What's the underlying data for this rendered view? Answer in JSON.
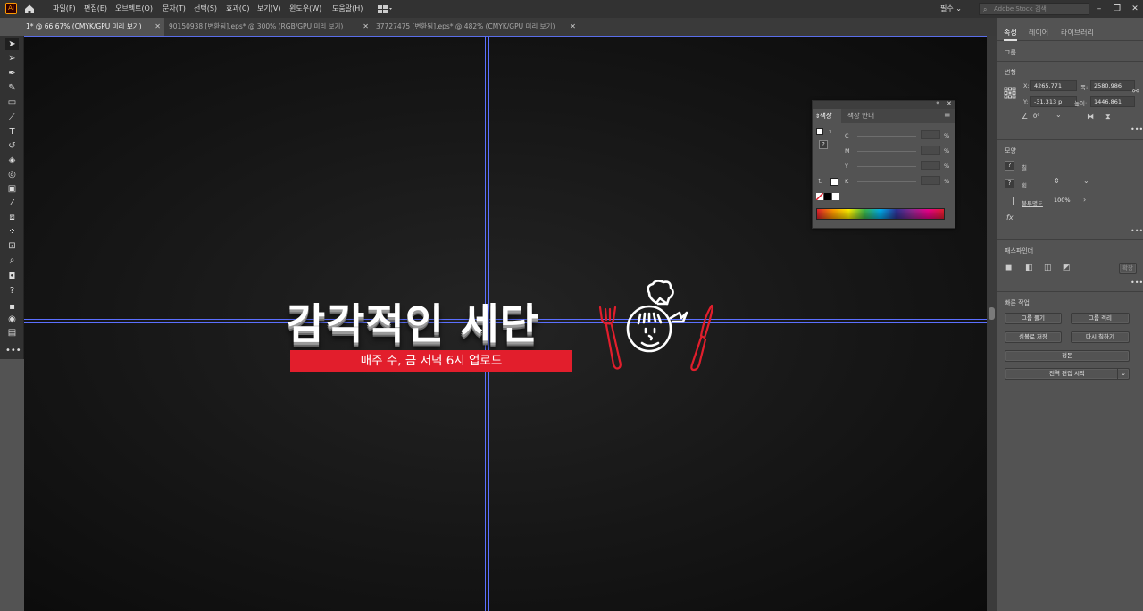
{
  "app": {
    "logo": "Ai"
  },
  "menu": [
    "파일(F)",
    "편집(E)",
    "오브젝트(O)",
    "문자(T)",
    "선택(S)",
    "효과(C)",
    "보기(V)",
    "윈도우(W)",
    "도움말(H)"
  ],
  "workspace": "필수",
  "search_placeholder": "Adobe Stock 검색",
  "tabs": [
    {
      "label": "1* @ 66.67% (CMYK/GPU 미리 보기)",
      "close": "✕"
    },
    {
      "label": "90150938 [변환됨].eps* @ 300% (RGB/GPU 미리 보기)",
      "close": "✕"
    },
    {
      "label": "37727475 [변환됨].eps* @ 482% (CMYK/GPU 미리 보기)",
      "close": "✕"
    }
  ],
  "artwork": {
    "title": "감각적인 세단",
    "subtitle": "매주 수, 금 저녁 6시 업로드"
  },
  "color_panel": {
    "tabs": [
      "색상",
      "색상 안내"
    ],
    "channels": [
      "C",
      "M",
      "Y",
      "K"
    ],
    "unit": "%"
  },
  "properties": {
    "tabs": [
      "속성",
      "레이어",
      "라이브러리"
    ],
    "selection_type": "그룹",
    "transform": {
      "title": "변형",
      "x_label": "X:",
      "x": "4265.771",
      "y_label": "Y:",
      "y": "-31.313 p",
      "w_label": "폭:",
      "w": "2580.986",
      "h_label": "높이:",
      "h": "1446.861",
      "angle": "0°"
    },
    "appearance": {
      "title": "모양",
      "fill_label": "칠",
      "stroke_label": "획",
      "opacity_label": "불투명도",
      "opacity": "100%",
      "fx": "fx."
    },
    "pathfinder": {
      "title": "패스파인더",
      "expand": "확장"
    },
    "quick_actions": {
      "title": "빠른 작업",
      "ungroup": "그룹 풀기",
      "isolate": "그룹 격리",
      "save_symbol": "심볼로 저장",
      "recolor": "다시 칠하기",
      "align": "정돈",
      "global_edit": "전역 편집 시작"
    }
  }
}
